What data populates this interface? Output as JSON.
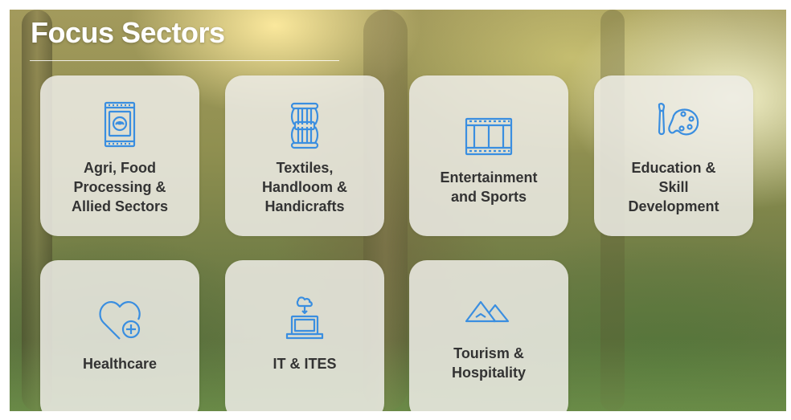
{
  "page": {
    "title": "Focus Sectors"
  },
  "colors": {
    "icon": "#3a8ee0",
    "text": "#333333",
    "card": "#eeece6"
  },
  "sectors": [
    {
      "label": "Agri, Food\nProcessing &\nAllied Sectors",
      "icon": "seed-packet-icon"
    },
    {
      "label": "Textiles,\nHandloom &\nHandicrafts",
      "icon": "yarn-spool-icon"
    },
    {
      "label": "Entertainment\nand Sports",
      "icon": "film-strip-icon"
    },
    {
      "label": "Education &\nSkill\nDevelopment",
      "icon": "paint-palette-icon"
    },
    {
      "label": "Healthcare",
      "icon": "heart-plus-icon"
    },
    {
      "label": "IT & ITES",
      "icon": "laptop-cloud-icon"
    },
    {
      "label": "Tourism &\nHospitality",
      "icon": "mountains-icon"
    }
  ]
}
